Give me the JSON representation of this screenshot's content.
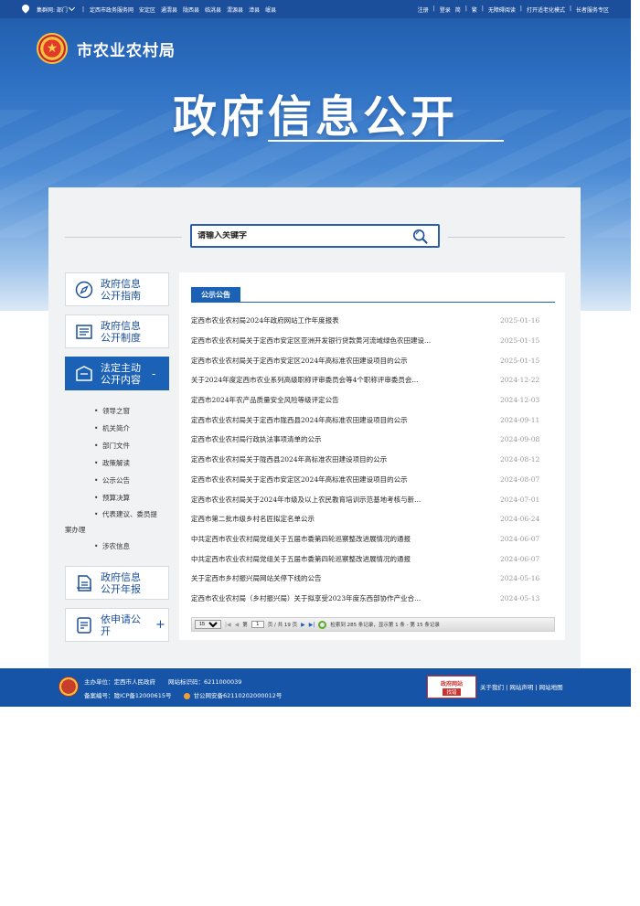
{
  "topbar": {
    "location": "集群网: 部门",
    "links": [
      "定西市政务服务网",
      "安定区",
      "通渭县",
      "陇西县",
      "临洮县",
      "渭源县",
      "漳县",
      "岷县"
    ],
    "right": [
      "注册",
      "登录",
      "简",
      "繁",
      "无障碍阅读",
      "打开适老化模式",
      "长者服务专区"
    ]
  },
  "header": {
    "org_name": "市农业农村局",
    "title": "政府信息公开"
  },
  "search": {
    "placeholder": "请输入关键字"
  },
  "sidebar": {
    "items": [
      {
        "label1": "政府信息",
        "label2": "公开指南",
        "icon": "compass-icon"
      },
      {
        "label1": "政府信息",
        "label2": "公开制度",
        "icon": "document-list-icon"
      },
      {
        "label1": "法定主动",
        "label2": "公开内容",
        "icon": "mail-icon",
        "active": true
      }
    ],
    "sub_items": [
      "领导之窗",
      "机关简介",
      "部门文件",
      "政策解读",
      "公示公告",
      "预算决算",
      "代表建议、委员提案办理",
      "涉农信息"
    ],
    "sub_item_wrap_a": "代表建议、委员提",
    "sub_item_wrap_b": "案办理",
    "bottom": [
      {
        "label1": "政府信息",
        "label2": "公开年报",
        "icon": "report-icon"
      },
      {
        "label1": "依申请公",
        "label2": "开",
        "icon": "apply-icon"
      }
    ],
    "collapse_mark": "-",
    "expand_mark": "+"
  },
  "content": {
    "tab_label": "公示公告",
    "rows": [
      {
        "title": "定西市农业农村局2024年政府网站工作年度报表",
        "date": "2025-01-16"
      },
      {
        "title": "定西市农业农村局关于定西市安定区亚洲开发银行贷款黄河流域绿色农田建设...",
        "date": "2025-01-15"
      },
      {
        "title": "定西市农业农村局关于定西市安定区2024年高标准农田建设项目的公示",
        "date": "2025-01-15"
      },
      {
        "title": "关于2024年度定西市农业系列高级职称评审委员会等4个职称评审委员会...",
        "date": "2024-12-22"
      },
      {
        "title": "定西市2024年农产品质量安全风险等级评定公告",
        "date": "2024-12-03"
      },
      {
        "title": "定西市农业农村局关于定西市陇西县2024年高标准农田建设项目的公示",
        "date": "2024-09-11"
      },
      {
        "title": "定西市农业农村局行政执法事项清单的公示",
        "date": "2024-09-08"
      },
      {
        "title": "定西市农业农村局关于陇西县2024年高标准农田建设项目的公示",
        "date": "2024-08-12"
      },
      {
        "title": "定西市农业农村局关于定西市安定区2024年高标准农田建设项目的公示",
        "date": "2024-08-07"
      },
      {
        "title": "定西市农业农村局关于2024年市级及以上农民教育培训示范基地考核与新...",
        "date": "2024-07-01"
      },
      {
        "title": "定西市第二批市级乡村名匠拟定名单公示",
        "date": "2024-06-24"
      },
      {
        "title": "中共定西市农业农村局党组关于五届市委第四轮巡察整改进展情况的通报",
        "date": "2024-06-07"
      },
      {
        "title": "中共定西市农业农村局党组关于五届市委第四轮巡察整改进展情况的通报",
        "date": "2024-06-07"
      },
      {
        "title": "关于定西市乡村振兴局网站关停下线的公告",
        "date": "2024-05-16"
      },
      {
        "title": "定西市农业农村局（乡村振兴局）关于拟享受2023年度东西部协作产业合...",
        "date": "2024-05-13"
      }
    ],
    "pager": {
      "page_size": "15",
      "page_label_a": "第",
      "page_value": "1",
      "page_label_b": "页 / 共 19 页",
      "summary": "检索到 285 条记录，显示第 1 条 - 第 15 条记录"
    }
  },
  "footer": {
    "sponsor": "主办单位：定西市人民政府",
    "site_code": "网站标识码：6211000039",
    "icp": "备案编号：陇ICP备12000615号",
    "police": "甘公网安备62110202000012号",
    "badge_a": "政府网站",
    "badge_b": "找错",
    "links": "关于我们 | 网站声明 | 网站地图"
  }
}
